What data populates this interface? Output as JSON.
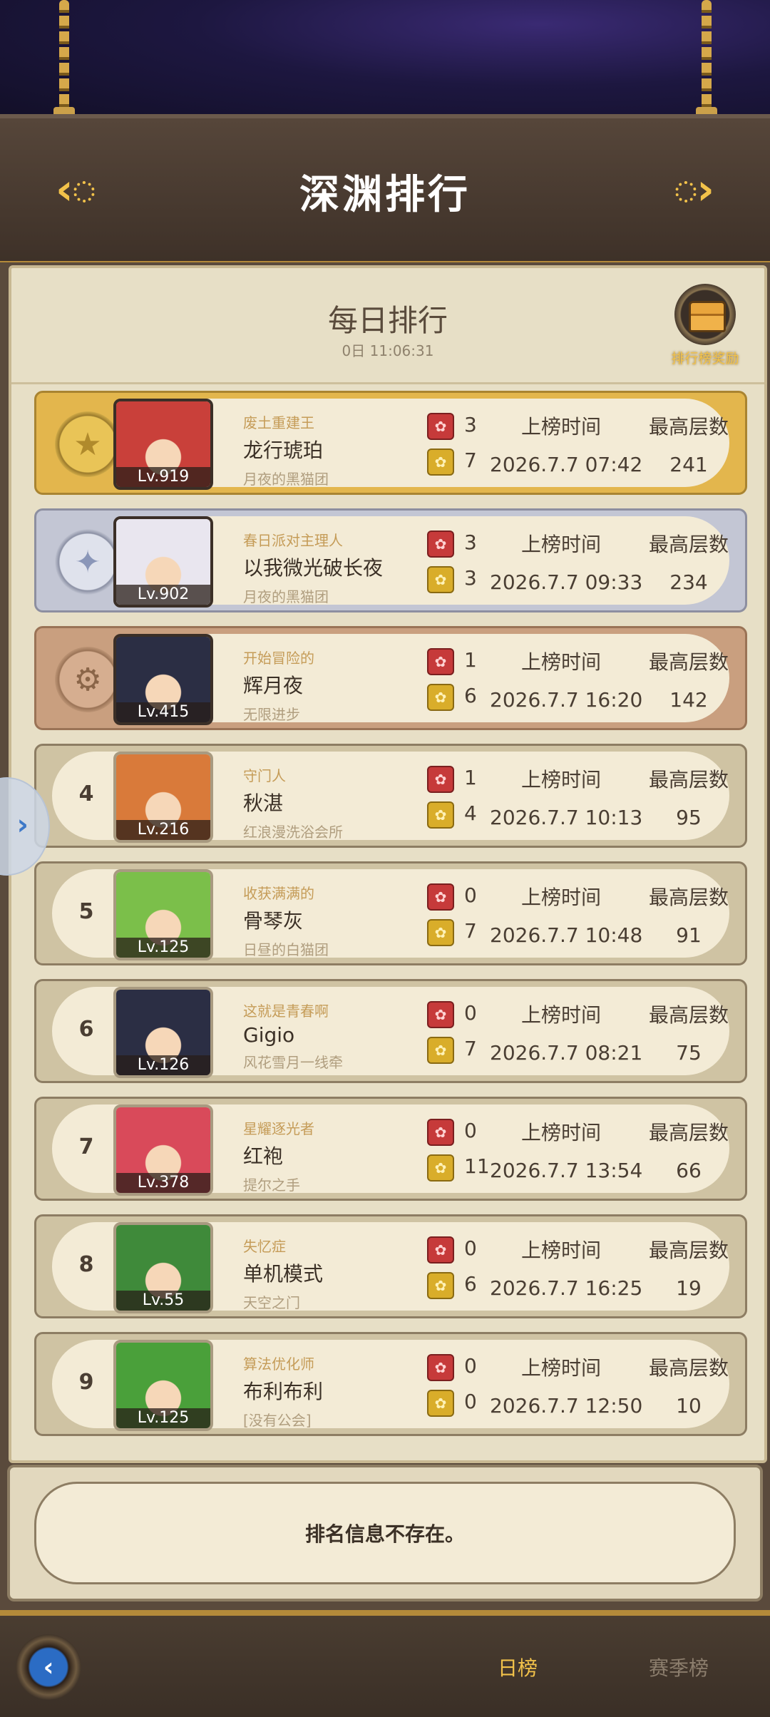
{
  "header": {
    "title": "深渊排行",
    "prev_icon": "chevron-left-gear-icon",
    "next_icon": "chevron-right-gear-icon"
  },
  "daily": {
    "title": "每日排行",
    "timer": "0日 11:06:31",
    "reward_label": "排行榜奖励",
    "reward_icon": "treasure-chest-icon"
  },
  "columns": {
    "time_label": "上榜时间",
    "floor_label": "最高层数"
  },
  "rows": [
    {
      "rank": "1",
      "medal": "gold",
      "level": "Lv.919",
      "title": "废土重建王",
      "name": "龙行琥珀",
      "guild": "月夜的黑猫团",
      "red": "3",
      "yellow": "7",
      "time": "2026.7.7 07:42",
      "floor": "241"
    },
    {
      "rank": "2",
      "medal": "silver",
      "level": "Lv.902",
      "title": "春日派对主理人",
      "name": "以我微光破长夜",
      "guild": "月夜的黑猫团",
      "red": "3",
      "yellow": "3",
      "time": "2026.7.7 09:33",
      "floor": "234"
    },
    {
      "rank": "3",
      "medal": "bronze",
      "level": "Lv.415",
      "title": "开始冒险的",
      "name": "辉月夜",
      "guild": "无限进步",
      "red": "1",
      "yellow": "6",
      "time": "2026.7.7 16:20",
      "floor": "142"
    },
    {
      "rank": "4",
      "medal": "",
      "level": "Lv.216",
      "title": "守门人",
      "name": "秋湛",
      "guild": "红浪漫洗浴会所",
      "red": "1",
      "yellow": "4",
      "time": "2026.7.7 10:13",
      "floor": "95"
    },
    {
      "rank": "5",
      "medal": "",
      "level": "Lv.125",
      "title": "收获满满的",
      "name": "骨琴灰",
      "guild": "日昼的白猫团",
      "red": "0",
      "yellow": "7",
      "time": "2026.7.7 10:48",
      "floor": "91"
    },
    {
      "rank": "6",
      "medal": "",
      "level": "Lv.126",
      "title": "这就是青春啊",
      "name": "Gigio",
      "guild": "风花雪月一线牵",
      "red": "0",
      "yellow": "7",
      "time": "2026.7.7 08:21",
      "floor": "75"
    },
    {
      "rank": "7",
      "medal": "",
      "level": "Lv.378",
      "title": "星耀逐光者",
      "name": "红袍",
      "guild": "提尔之手",
      "red": "0",
      "yellow": "11",
      "time": "2026.7.7 13:54",
      "floor": "66"
    },
    {
      "rank": "8",
      "medal": "",
      "level": "Lv.55",
      "title": "失忆症",
      "name": "单机模式",
      "guild": "天空之门",
      "red": "0",
      "yellow": "6",
      "time": "2026.7.7 16:25",
      "floor": "19"
    },
    {
      "rank": "9",
      "medal": "",
      "level": "Lv.125",
      "title": "算法优化师",
      "name": "布利布利",
      "guild": "[没有公会]",
      "red": "0",
      "yellow": "0",
      "time": "2026.7.7 12:50",
      "floor": "10"
    }
  ],
  "my_rank": {
    "message": "排名信息不存在。"
  },
  "footer": {
    "back_icon": "back-arrow-icon",
    "tab_daily": "日榜",
    "tab_season": "赛季榜"
  },
  "colors": {
    "accent_gold": "#f2c24a",
    "parchment": "#e7dfc6",
    "wood": "#4a3d31",
    "badge_red": "#c63a3a",
    "badge_yellow": "#d9ad2a",
    "avatar_bgs": [
      "#c9403a",
      "#e9e6ef",
      "#2b2e44",
      "#d97a3a",
      "#7bbf4a",
      "#2b2e44",
      "#d94a5a",
      "#3f8a3a",
      "#4aa03a"
    ]
  }
}
